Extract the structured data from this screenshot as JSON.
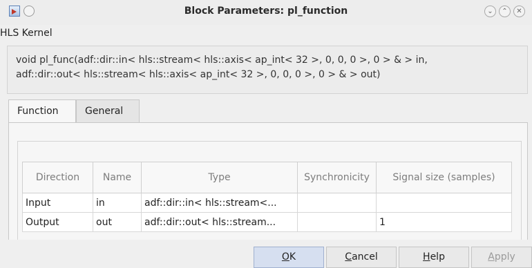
{
  "window": {
    "title": "Block Parameters: pl_function"
  },
  "kernel": {
    "label": "HLS Kernel",
    "signature_line1": "void pl_func(adf::dir::in< hls::stream< hls::axis< ap_int< 32 >, 0, 0, 0 >, 0 > & > in,",
    "signature_line2": "adf::dir::out< hls::stream< hls::axis< ap_int< 32 >, 0, 0, 0 >, 0 > & > out)"
  },
  "tabs": [
    {
      "label": "Function",
      "active": true
    },
    {
      "label": "General",
      "active": false
    }
  ],
  "table": {
    "headers": [
      "Direction",
      "Name",
      "Type",
      "Synchronicity",
      "Signal size (samples)"
    ],
    "rows": [
      [
        "Input",
        "in",
        "adf::dir::in< hls::stream<...",
        "",
        ""
      ],
      [
        "Output",
        "out",
        "adf::dir::out< hls::stream...",
        "",
        "1"
      ]
    ]
  },
  "buttons": {
    "ok": {
      "mnemonic": "O",
      "rest": "K"
    },
    "cancel": {
      "mnemonic": "C",
      "rest": "ancel"
    },
    "help": {
      "mnemonic": "H",
      "rest": "elp"
    },
    "apply": {
      "mnemonic": "A",
      "rest": "pply"
    }
  },
  "icons": {
    "app": "simulink-block-icon",
    "window_controls": [
      "minimize-icon",
      "maximize-icon",
      "close-icon"
    ]
  }
}
